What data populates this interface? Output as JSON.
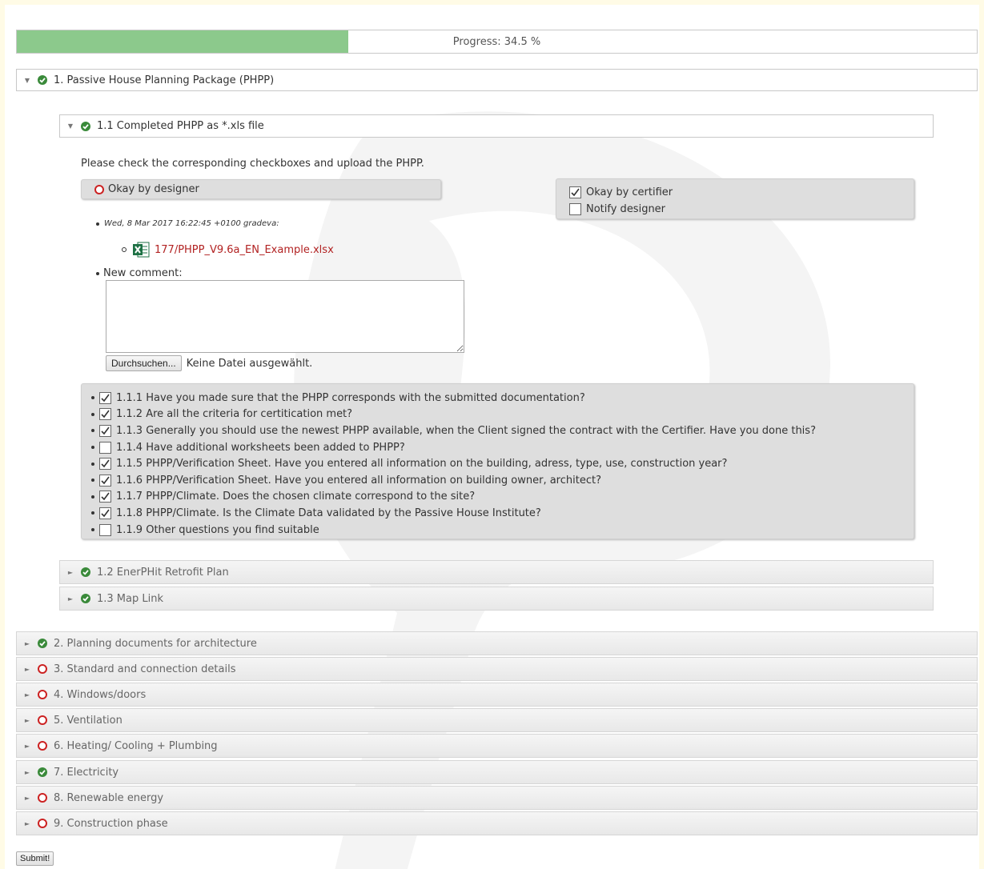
{
  "progress": {
    "label": "Progress: 34.5 %",
    "value": 34.5
  },
  "sections": [
    {
      "label": "1. Passive House Planning Package (PHPP)",
      "status": "ok",
      "expanded": true
    },
    {
      "label": "2. Planning documents for architecture",
      "status": "ok"
    },
    {
      "label": "3. Standard and connection details",
      "status": "error"
    },
    {
      "label": "4. Windows/doors",
      "status": "error"
    },
    {
      "label": "5. Ventilation",
      "status": "error"
    },
    {
      "label": "6. Heating/ Cooling + Plumbing",
      "status": "error"
    },
    {
      "label": "7. Electricity",
      "status": "ok"
    },
    {
      "label": "8. Renewable energy",
      "status": "error"
    },
    {
      "label": "9. Construction phase",
      "status": "error"
    }
  ],
  "subsections": [
    {
      "label": "1.1 Completed PHPP as *.xls file",
      "status": "ok",
      "expanded": true
    },
    {
      "label": "1.2 EnerPHit Retrofit Plan",
      "status": "ok"
    },
    {
      "label": "1.3 Map Link",
      "status": "ok"
    }
  ],
  "detail": {
    "instruction": "Please check the corresponding checkboxes and upload the PHPP.",
    "designer_label": "Okay by designer",
    "certifier_label": "Okay by certifier",
    "certifier_checked": true,
    "notify_label": "Notify designer",
    "notify_checked": false,
    "comment_meta": "Wed, 8 Mar 2017 16:22:45 +0100 gradeva:",
    "file_name": "177/PHPP_V9.6a_EN_Example.xlsx",
    "new_comment_label": "New comment:",
    "comment_value": "",
    "browse_label": "Durchsuchen...",
    "no_file_label": "Keine Datei ausgewählt."
  },
  "questions": [
    {
      "text": "1.1.1 Have you made sure that the PHPP corresponds with the submitted documentation?",
      "checked": true
    },
    {
      "text": "1.1.2 Are all the criteria for certitication met?",
      "checked": true
    },
    {
      "text": "1.1.3 Generally you should use the newest PHPP available, when the Client signed the contract with the Certifier. Have you done this?",
      "checked": true
    },
    {
      "text": "1.1.4 Have additional worksheets been added to PHPP?",
      "checked": false
    },
    {
      "text": "1.1.5 PHPP/Verification Sheet. Have you entered all information on the building, adress, type, use, construction year?",
      "checked": true
    },
    {
      "text": "1.1.6 PHPP/Verification Sheet. Have you entered all information on building owner, architect?",
      "checked": true
    },
    {
      "text": "1.1.7 PHPP/Climate. Does the chosen climate correspond to the site?",
      "checked": true
    },
    {
      "text": "1.1.8 PHPP/Climate. Is the Climate Data validated by the Passive House Institute?",
      "checked": true
    },
    {
      "text": "1.1.9 Other questions you find suitable",
      "checked": false
    }
  ],
  "submit_label": "Submit!",
  "colors": {
    "ok": "#3a8a3a",
    "error": "#cc2222",
    "progress": "#8cc98c",
    "link": "#b22222"
  }
}
